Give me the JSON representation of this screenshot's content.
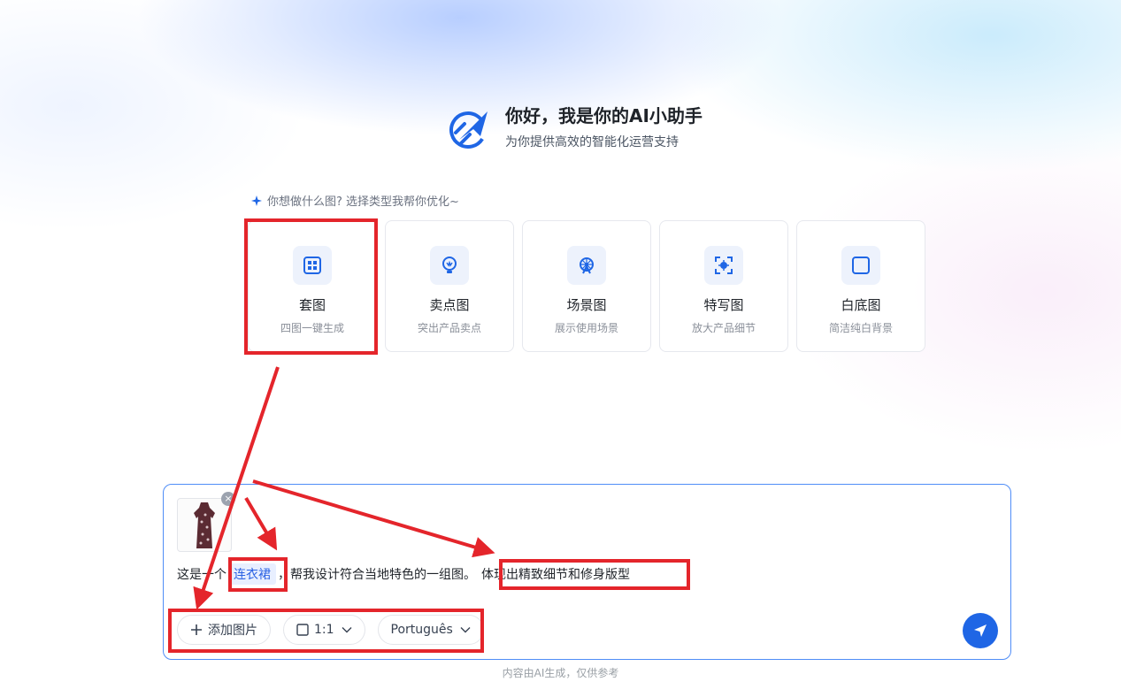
{
  "header": {
    "title": "你好，我是你的AI小助手",
    "subtitle": "为你提供高效的智能化运营支持",
    "logo_icon": "rocket-logo-icon"
  },
  "hint": {
    "icon": "sparkle-icon",
    "text": "你想做什么图? 选择类型我帮你优化~"
  },
  "cards": [
    {
      "title": "套图",
      "desc": "四图一键生成",
      "icon": "grid-icon"
    },
    {
      "title": "卖点图",
      "desc": "突出产品卖点",
      "icon": "bulb-icon"
    },
    {
      "title": "场景图",
      "desc": "展示使用场景",
      "icon": "ferris-wheel-icon"
    },
    {
      "title": "特写图",
      "desc": "放大产品细节",
      "icon": "focus-icon"
    },
    {
      "title": "白底图",
      "desc": "简洁纯白背景",
      "icon": "square-icon"
    }
  ],
  "input": {
    "attachment_icon": "dress-thumbnail",
    "prompt_prefix": "这是一个",
    "prompt_product": "连衣裙",
    "prompt_middle": "，帮我设计符合当地特色的一组图。",
    "prompt_detail": "体现出精致细节和修身版型"
  },
  "toolbar": {
    "add_image_label": "添加图片",
    "ratio_label": "1:1",
    "language_label": "Português"
  },
  "footnote": "内容由AI生成，仅供参考",
  "colors": {
    "accent": "#1f66e5",
    "annotation_red": "#e4252b",
    "chip_bg": "#e8efff"
  }
}
